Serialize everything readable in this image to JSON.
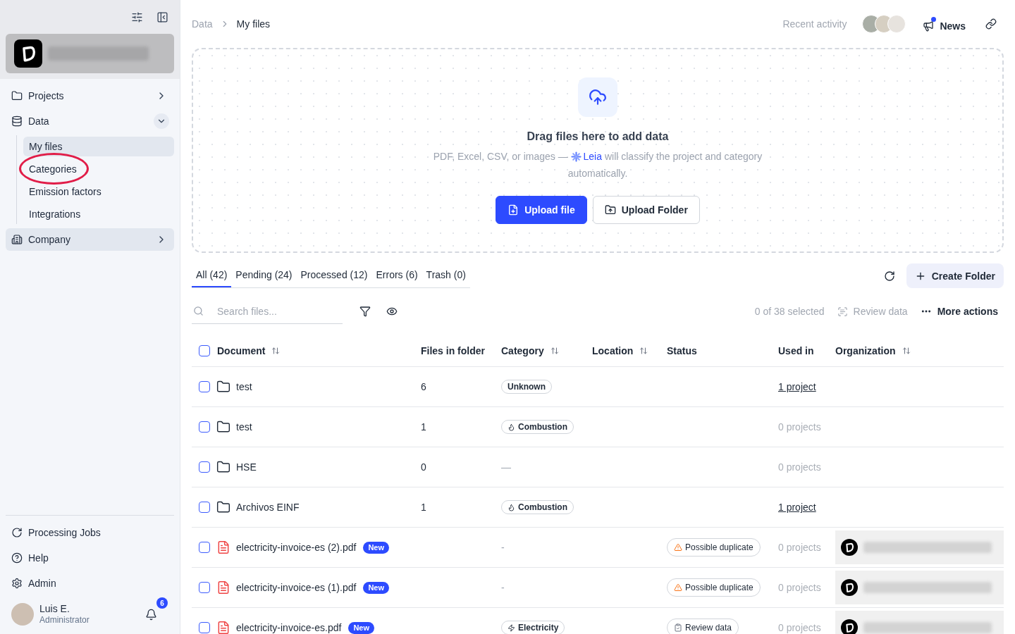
{
  "sidebar": {
    "org_card": {
      "name_redacted": true
    },
    "nav": [
      {
        "label": "Projects",
        "expanded": false,
        "highlighted": false
      },
      {
        "label": "Data",
        "expanded": true,
        "highlighted": false,
        "children": [
          {
            "label": "My files",
            "selected": true,
            "circled": false
          },
          {
            "label": "Categories",
            "selected": false,
            "circled": true
          },
          {
            "label": "Emission factors",
            "selected": false,
            "circled": false
          },
          {
            "label": "Integrations",
            "selected": false,
            "circled": false
          }
        ]
      },
      {
        "label": "Company",
        "expanded": false,
        "highlighted": true
      }
    ],
    "footer": [
      {
        "label": "Processing Jobs"
      },
      {
        "label": "Help"
      },
      {
        "label": "Admin"
      }
    ],
    "user": {
      "name": "Luis E.",
      "role": "Administrator",
      "notifications": "6"
    }
  },
  "breadcrumb": [
    {
      "label": "Data"
    },
    {
      "label": "My files"
    }
  ],
  "header": {
    "recent_activity": "Recent activity",
    "news": {
      "label": "News",
      "unread": true
    }
  },
  "dropzone": {
    "title": "Drag files here to add data",
    "description": {
      "before": "PDF, Excel, CSV, or images —",
      "link": "Leia",
      "after": "will classify the project and category automatically."
    },
    "buttons": [
      {
        "label": "Upload file",
        "kind": "primary"
      },
      {
        "label": "Upload Folder",
        "kind": "secondary"
      }
    ]
  },
  "tabs": [
    {
      "label": "All (42)",
      "selected": true
    },
    {
      "label": "Pending (24)",
      "selected": false
    },
    {
      "label": "Processed (12)",
      "selected": false
    },
    {
      "label": "Errors (6)",
      "selected": false
    },
    {
      "label": "Trash (0)",
      "selected": false
    }
  ],
  "create_folder": "Create Folder",
  "toolbar": {
    "search": {
      "placeholder": "Search files..."
    },
    "selection": "0 of 38 selected",
    "review": {
      "label": "Review data",
      "disabled": true
    },
    "more": "More actions"
  },
  "table": {
    "select_all_checked": false,
    "columns": [
      {
        "label": "Document",
        "sortable": true
      },
      {
        "label": "Files in folder",
        "sortable": false
      },
      {
        "label": "Category",
        "sortable": true
      },
      {
        "label": "Location",
        "sortable": true
      },
      {
        "label": "Status",
        "sortable": false
      },
      {
        "label": "Used in",
        "sortable": false
      },
      {
        "label": "Organization",
        "sortable": true
      }
    ],
    "rows": [
      {
        "checked": false,
        "kind": "folder",
        "name": "test",
        "files": "6",
        "category": {
          "kind": "unknown",
          "label": "Unknown"
        },
        "used_in": {
          "label": "1 project",
          "linked": true
        },
        "organization_redacted": false
      },
      {
        "checked": false,
        "kind": "folder",
        "name": "test",
        "files": "1",
        "category": {
          "kind": "combustion",
          "label": "Combustion"
        },
        "used_in": {
          "label": "0 projects",
          "linked": false
        },
        "organization_redacted": false
      },
      {
        "checked": false,
        "kind": "folder",
        "name": "HSE",
        "files": "0",
        "category": {
          "kind": "none",
          "label": "—"
        },
        "used_in": {
          "label": "0 projects",
          "linked": false
        },
        "organization_redacted": false
      },
      {
        "checked": false,
        "kind": "folder",
        "name": "Archivos EINF",
        "files": "1",
        "category": {
          "kind": "combustion",
          "label": "Combustion"
        },
        "used_in": {
          "label": "1 project",
          "linked": true
        },
        "organization_redacted": false
      },
      {
        "checked": false,
        "kind": "pdf",
        "name": "electricity-invoice-es (2).pdf",
        "badge": "New",
        "category": {
          "kind": "none",
          "label": "-"
        },
        "status": {
          "kind": "warning",
          "label": "Possible duplicate"
        },
        "used_in": {
          "label": "0 projects",
          "linked": false
        },
        "organization_redacted": true
      },
      {
        "checked": false,
        "kind": "pdf",
        "name": "electricity-invoice-es (1).pdf",
        "badge": "New",
        "category": {
          "kind": "none",
          "label": "-"
        },
        "status": {
          "kind": "warning",
          "label": "Possible duplicate"
        },
        "used_in": {
          "label": "0 projects",
          "linked": false
        },
        "organization_redacted": true
      },
      {
        "checked": false,
        "kind": "pdf",
        "name": "electricity-invoice-es.pdf",
        "badge": "New",
        "category": {
          "kind": "electricity",
          "label": "Electricity"
        },
        "status": {
          "kind": "review",
          "label": "Review data"
        },
        "used_in": {
          "label": "0 projects",
          "linked": false
        },
        "organization_redacted": true
      }
    ]
  }
}
